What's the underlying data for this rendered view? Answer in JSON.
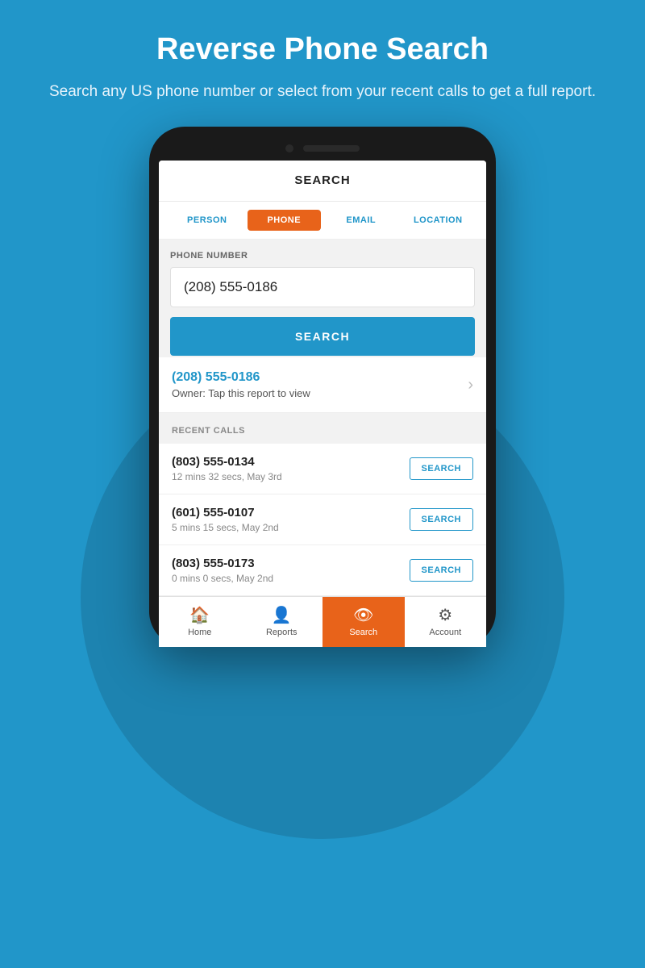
{
  "header": {
    "title": "Reverse Phone Search",
    "subtitle": "Search any US phone number or select from your recent calls to get a full report."
  },
  "app": {
    "screen_title": "SEARCH",
    "tabs": [
      {
        "id": "person",
        "label": "PERSON",
        "active": false
      },
      {
        "id": "phone",
        "label": "PHONE",
        "active": true
      },
      {
        "id": "email",
        "label": "EMAIL",
        "active": false
      },
      {
        "id": "location",
        "label": "LOCATION",
        "active": false
      }
    ],
    "phone_field": {
      "label": "PHONE NUMBER",
      "value": "(208) 555-0186"
    },
    "search_button_label": "SEARCH",
    "result": {
      "number": "(208) 555-0186",
      "owner_text": "Owner: Tap this report to view"
    },
    "recent_calls_label": "RECENT CALLS",
    "recent_calls": [
      {
        "number": "(803) 555-0134",
        "meta": "12 mins 32 secs, May 3rd",
        "search_label": "SEARCH"
      },
      {
        "number": "(601) 555-0107",
        "meta": "5 mins 15 secs, May 2nd",
        "search_label": "SEARCH"
      },
      {
        "number": "(803) 555-0173",
        "meta": "0 mins 0 secs, May 2nd",
        "search_label": "SEARCH"
      }
    ],
    "nav": [
      {
        "id": "home",
        "label": "Home",
        "icon": "🏠",
        "active": false
      },
      {
        "id": "reports",
        "label": "Reports",
        "icon": "👤",
        "active": false
      },
      {
        "id": "search",
        "label": "Search",
        "icon": "👁",
        "active": true
      },
      {
        "id": "account",
        "label": "Account",
        "icon": "⚙",
        "active": false
      }
    ]
  },
  "colors": {
    "background": "#2196c9",
    "active_tab": "#e8631a",
    "search_button": "#2196c9",
    "result_number": "#2196c9",
    "nav_active": "#e8631a"
  }
}
